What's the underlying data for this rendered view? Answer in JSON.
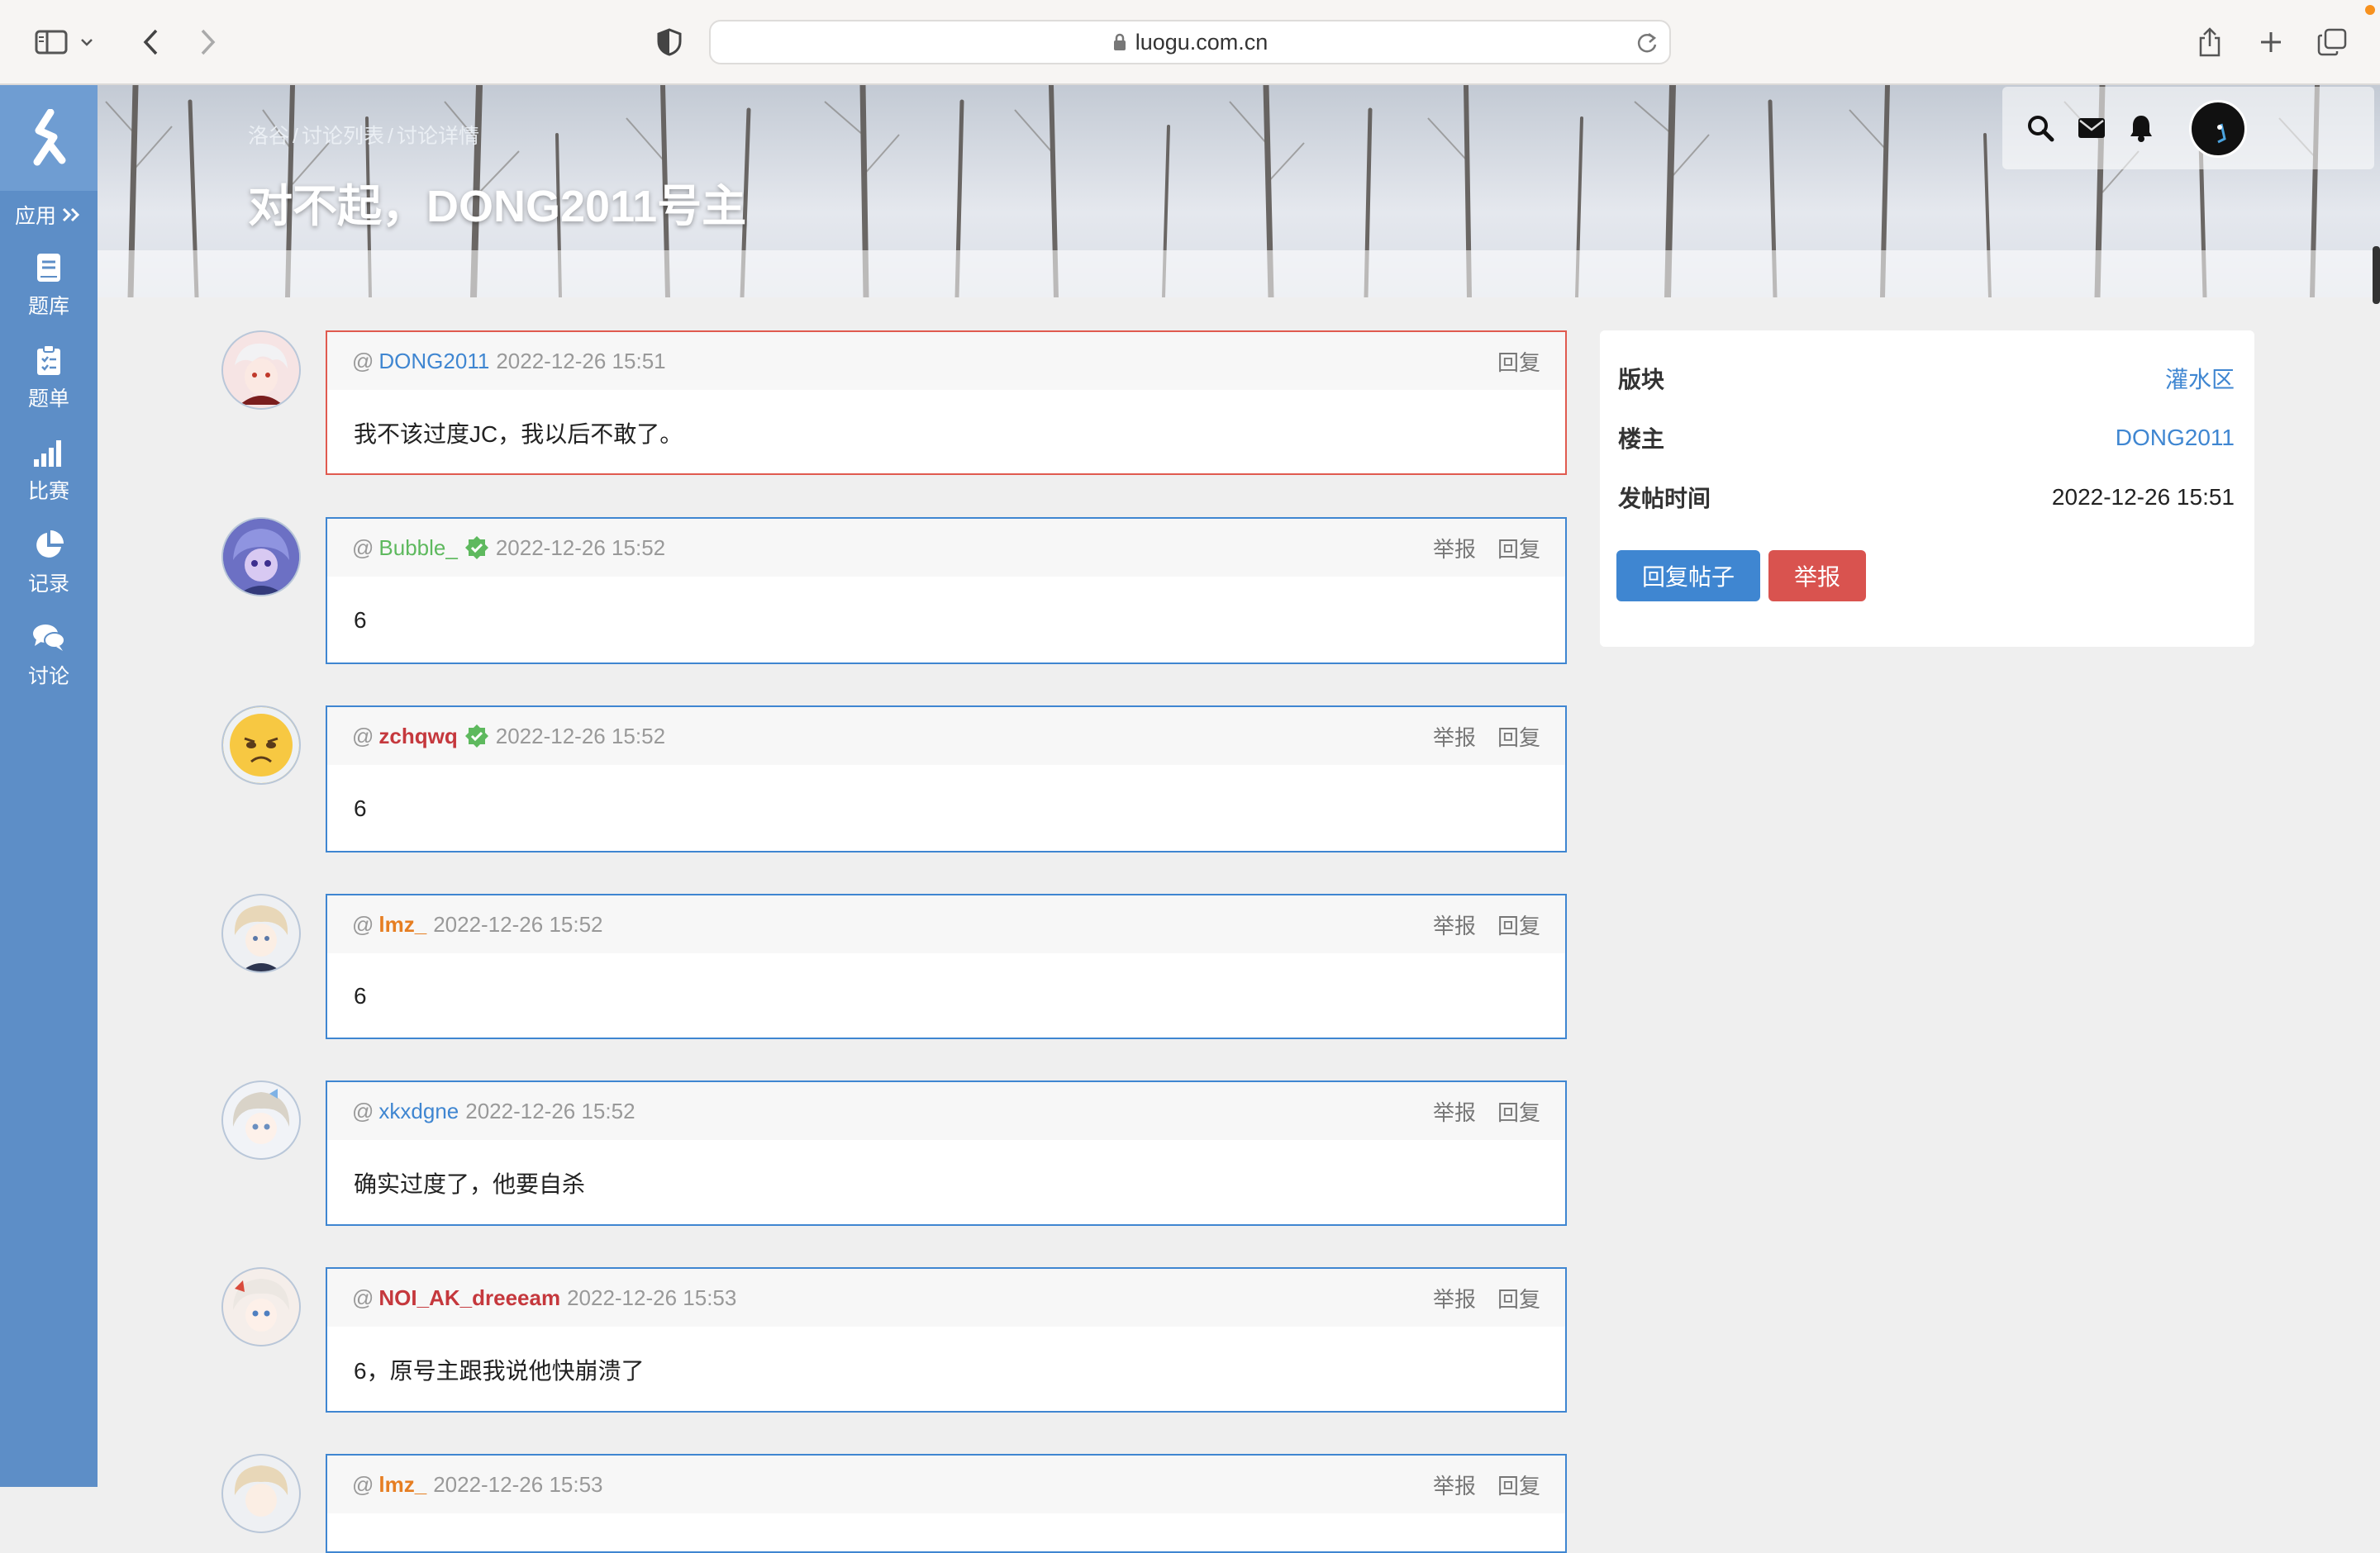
{
  "browser": {
    "url": "luogu.com.cn"
  },
  "sidebar": {
    "app_label": "应用",
    "items": [
      {
        "label": "题库",
        "icon": "book-icon"
      },
      {
        "label": "题单",
        "icon": "clipboard-icon"
      },
      {
        "label": "比赛",
        "icon": "signal-bars-icon"
      },
      {
        "label": "记录",
        "icon": "pie-chart-icon"
      },
      {
        "label": "讨论",
        "icon": "comments-icon"
      }
    ]
  },
  "header": {
    "breadcrumb": [
      "洛谷",
      "/",
      "讨论列表",
      "/",
      "讨论详情"
    ],
    "title": "对不起，DONG2011号主"
  },
  "posts": [
    {
      "user": "DONG2011",
      "user_color": "#3f86d1",
      "verified": false,
      "time": "2022-12-26 15:51",
      "report": "",
      "reply": "回复",
      "content": "我不该过度JC，我以后不敢了。",
      "avatar_color": "#f3dcdc"
    },
    {
      "user": "Bubble_",
      "user_color": "#5eb95e",
      "verified": true,
      "time": "2022-12-26 15:52",
      "report": "举报",
      "reply": "回复",
      "content": "6",
      "avatar_color": "#5a5fb0"
    },
    {
      "user": "zchqwq",
      "user_color": "#c5383d",
      "verified": true,
      "time": "2022-12-26 15:52",
      "report": "举报",
      "reply": "回复",
      "content": "6",
      "avatar_color": "#f6c73e"
    },
    {
      "user": "lmz_",
      "user_color": "#e67e22",
      "verified": false,
      "time": "2022-12-26 15:52",
      "report": "举报",
      "reply": "回复",
      "content": "6",
      "avatar_color": "#e9ddd0"
    },
    {
      "user": "xkxdgne",
      "user_color": "#3f86d1",
      "verified": false,
      "time": "2022-12-26 15:52",
      "report": "举报",
      "reply": "回复",
      "content": "确实过度了，他要自杀",
      "avatar_color": "#e3e6ee"
    },
    {
      "user": "NOI_AK_dreeeam",
      "user_color": "#c5383d",
      "verified": false,
      "time": "2022-12-26 15:53",
      "report": "举报",
      "reply": "回复",
      "content": "6，原号主跟我说他快崩溃了",
      "avatar_color": "#f0e2dc"
    },
    {
      "user": "lmz_",
      "user_color": "#e67e22",
      "verified": false,
      "time": "2022-12-26 15:53",
      "report": "举报",
      "reply": "回复",
      "content": "",
      "avatar_color": "#e9ddd0"
    }
  ],
  "info_panel": {
    "section_label": "版块",
    "section_value": "灌水区",
    "owner_label": "楼主",
    "owner_value": "DONG2011",
    "time_label": "发帖时间",
    "time_value": "2022-12-26 15:51",
    "reply_button": "回复帖子",
    "report_button": "举报"
  },
  "colors": {
    "nav_bg": "#5d8ec7",
    "link_blue": "#3f86d1",
    "danger_red": "#d9534f",
    "op_border": "#e05a4f"
  }
}
